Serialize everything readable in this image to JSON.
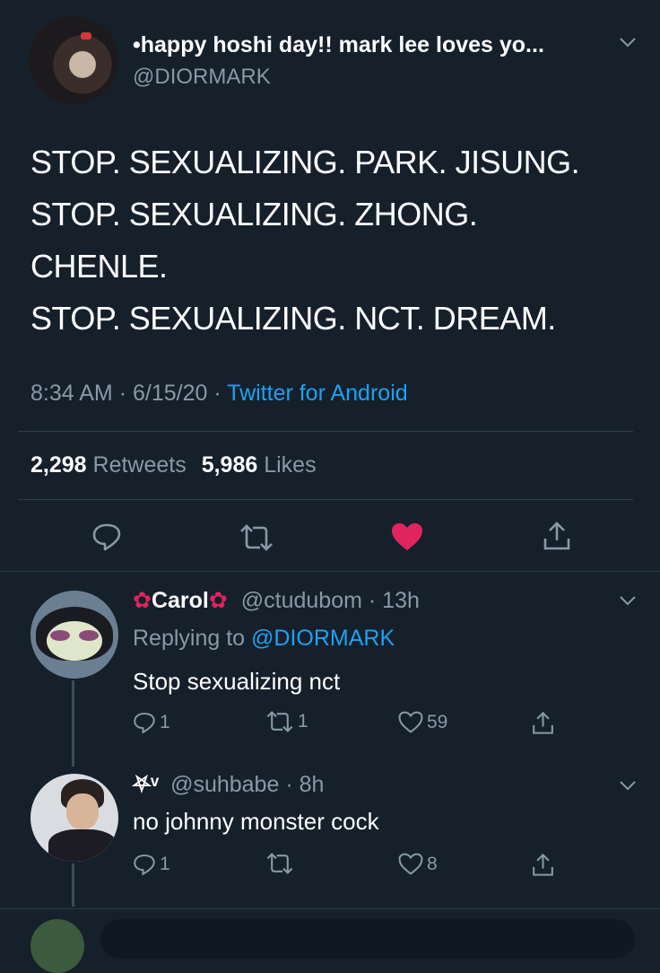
{
  "main_tweet": {
    "display_name": "•happy hoshi day!! mark lee loves yo...",
    "handle": "@DIORMARK",
    "text_lines": [
      "STOP. SEXUALIZING. PARK. JISUNG.",
      "STOP. SEXUALIZING. ZHONG.",
      "CHENLE.",
      "STOP. SEXUALIZING. NCT. DREAM."
    ],
    "time": "8:34 AM",
    "date": "6/15/20",
    "sep": "·",
    "source": "Twitter for Android",
    "retweets_count": "2,298",
    "retweets_label": "Retweets",
    "likes_count": "5,986",
    "likes_label": "Likes"
  },
  "replies": [
    {
      "display_name": "Carol",
      "handle": "@ctudubom",
      "time": "· 13h",
      "replying_prefix": "Replying to",
      "replying_handle": "@DIORMARK",
      "text": "Stop sexualizing nct",
      "reply_count": "1",
      "retweet_count": "1",
      "like_count": "59"
    },
    {
      "display_name": "⛧ᵛ",
      "handle": "@suhbabe",
      "time": "· 8h",
      "text": "no johnny monster cock",
      "reply_count": "1",
      "retweet_count": "",
      "like_count": "8"
    }
  ],
  "colors": {
    "background": "#15202b",
    "accent": "#1da1f2",
    "like": "#e0245e",
    "muted": "#8899a6"
  }
}
